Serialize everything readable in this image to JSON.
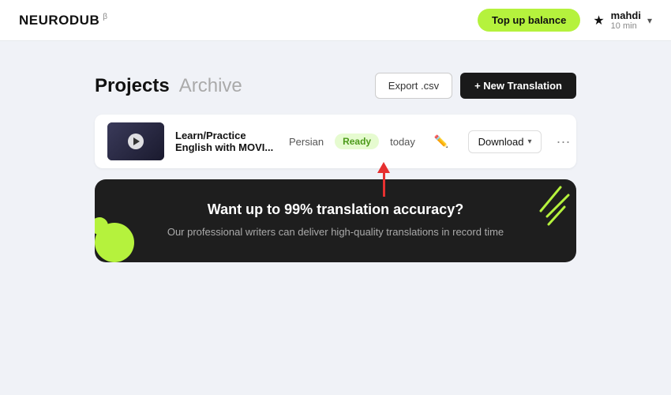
{
  "header": {
    "logo": "NEURODUB",
    "logo_beta": "β",
    "top_up_label": "Top up balance",
    "user": {
      "name": "mahdi",
      "time": "10 min"
    },
    "chevron": "▾"
  },
  "projects": {
    "title": "Projects",
    "archive_label": "Archive",
    "export_label": "Export .csv",
    "new_translation_label": "+ New Translation"
  },
  "project_row": {
    "name": "Learn/Practice English with MOVI...",
    "language": "Persian",
    "status": "Ready",
    "date": "today",
    "download_label": "Download",
    "download_chevron": "▾"
  },
  "promo": {
    "title": "Want up to 99% translation accuracy?",
    "description": "Our professional writers can deliver high-quality translations in record time"
  }
}
